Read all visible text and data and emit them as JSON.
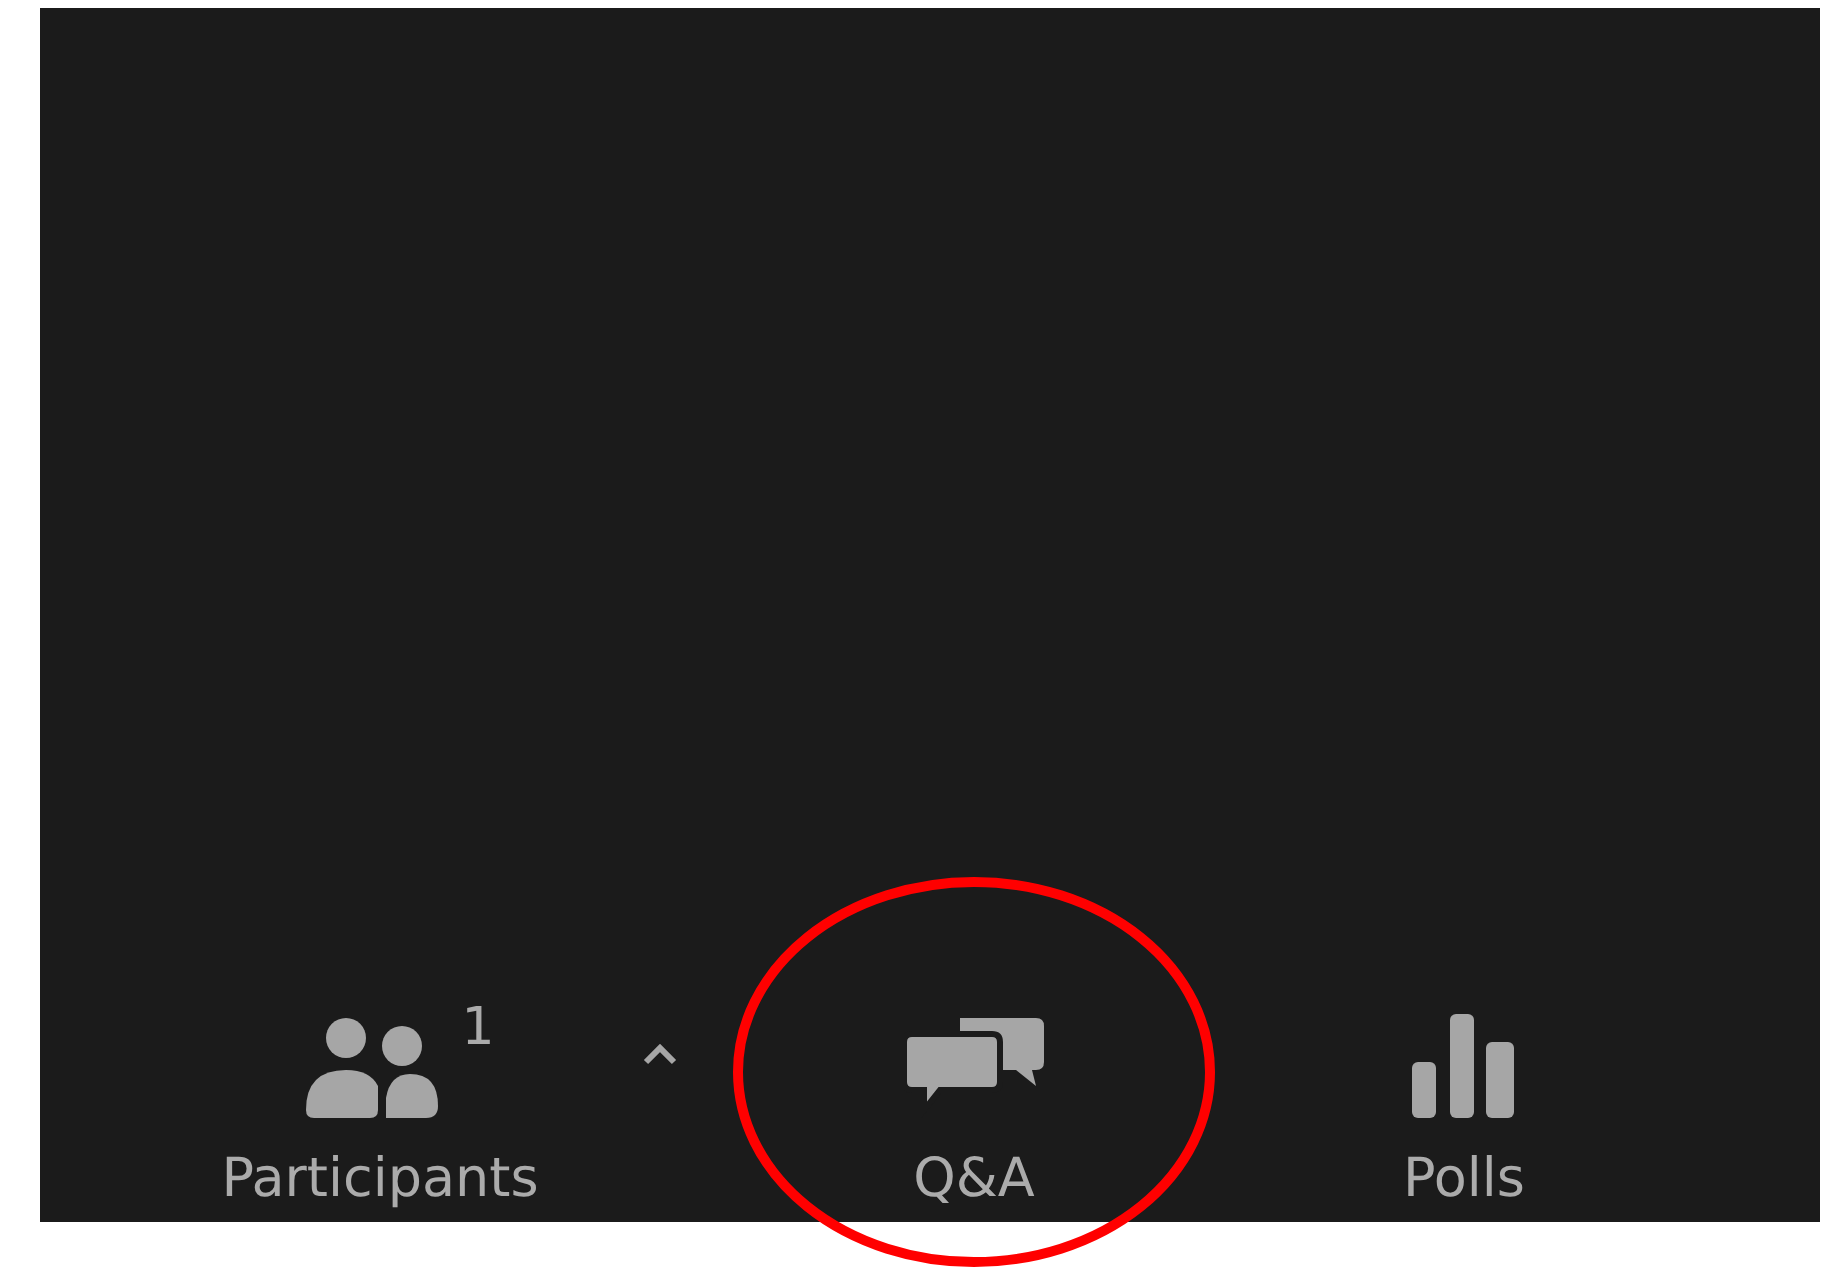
{
  "toolbar": {
    "items": [
      {
        "kind": "participants",
        "label": "Participants",
        "count": "1",
        "highlighted": false
      },
      {
        "kind": "caret"
      },
      {
        "kind": "qa",
        "label": "Q&A",
        "highlighted": true
      },
      {
        "kind": "polls",
        "label": "Polls",
        "highlighted": false
      }
    ]
  }
}
